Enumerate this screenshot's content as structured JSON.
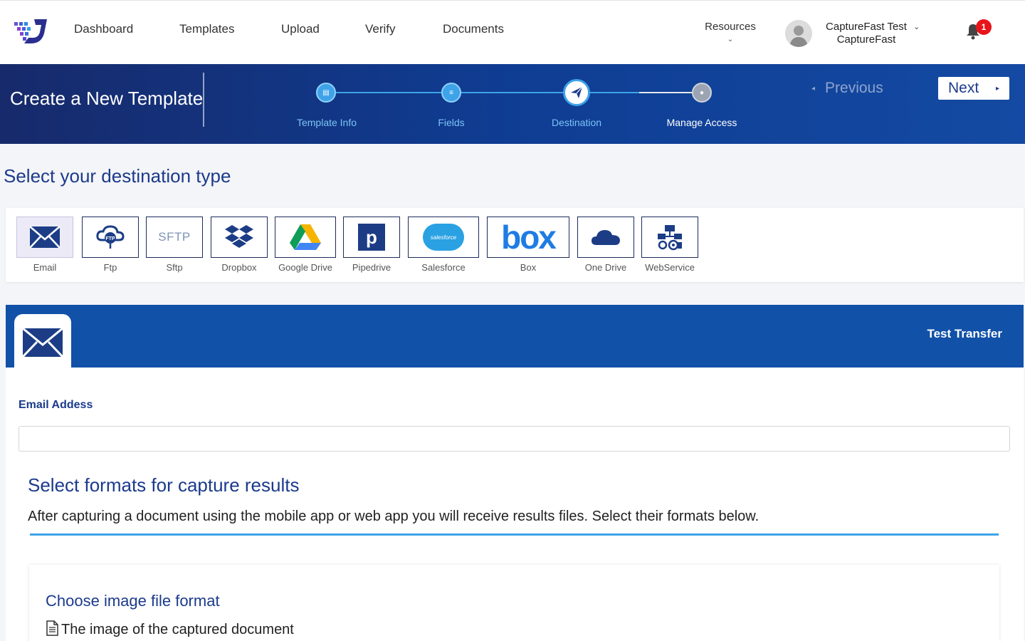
{
  "nav": {
    "links": [
      "Dashboard",
      "Templates",
      "Upload",
      "Verify",
      "Documents"
    ],
    "resources": "Resources",
    "user_name": "CaptureFast Test",
    "user_org": "CaptureFast",
    "notification_count": "1"
  },
  "banner": {
    "title": "Create a New Template",
    "steps": [
      {
        "label": "Template Info",
        "state": "done"
      },
      {
        "label": "Fields",
        "state": "done"
      },
      {
        "label": "Destination",
        "state": "active"
      },
      {
        "label": "Manage Access",
        "state": "pending"
      }
    ],
    "previous": "Previous",
    "next": "Next"
  },
  "destination": {
    "title": "Select your destination type",
    "types": [
      {
        "label": "Email",
        "icon": "envelope-icon",
        "selected": true
      },
      {
        "label": "Ftp",
        "icon": "ftp-cloud-icon"
      },
      {
        "label": "Sftp",
        "icon": "sftp-text-icon",
        "icon_text": "SFTP"
      },
      {
        "label": "Dropbox",
        "icon": "dropbox-icon"
      },
      {
        "label": "Google Drive",
        "icon": "google-drive-icon"
      },
      {
        "label": "Pipedrive",
        "icon": "pipedrive-icon",
        "icon_text": "p"
      },
      {
        "label": "Salesforce",
        "icon": "salesforce-icon",
        "icon_text": "salesforce"
      },
      {
        "label": "Box",
        "icon": "box-icon",
        "icon_text": "box"
      },
      {
        "label": "One Drive",
        "icon": "onedrive-icon"
      },
      {
        "label": "WebService",
        "icon": "webservice-icon"
      }
    ]
  },
  "email": {
    "test_transfer": "Test Transfer",
    "address_label": "Email Addess",
    "address_value": "",
    "formats_title": "Select formats for capture results",
    "formats_desc": "After capturing a document using the mobile app or web app you will receive results files. Select their formats below.",
    "image_title": "Choose image file format",
    "image_desc": "The image of the captured document"
  },
  "colors": {
    "brand_navy": "#1b3a8c",
    "banner_blue": "#1151a8",
    "accent_blue": "#3ea3e8",
    "badge_red": "#e8141b"
  }
}
